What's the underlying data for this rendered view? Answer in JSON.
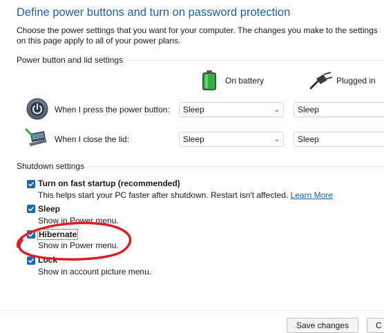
{
  "header": {
    "title": "Define power buttons and turn on password protection",
    "description": "Choose the power settings that you want for your computer. The changes you make to the settings on this page apply to all of your power plans."
  },
  "power_section": {
    "label": "Power button and lid settings",
    "columns": {
      "battery": "On battery",
      "plugged": "Plugged in"
    },
    "rows": [
      {
        "label": "When I press the power button:",
        "battery": "Sleep",
        "plugged": "Sleep"
      },
      {
        "label": "When I close the lid:",
        "battery": "Sleep",
        "plugged": "Sleep"
      }
    ]
  },
  "shutdown_section": {
    "label": "Shutdown settings",
    "options": [
      {
        "title": "Turn on fast startup (recommended)",
        "desc": "This helps start your PC faster after shutdown. Restart isn't affected.",
        "link": "Learn More",
        "checked": true
      },
      {
        "title": "Sleep",
        "desc": "Show in Power menu.",
        "checked": true
      },
      {
        "title": "Hibernate",
        "desc": "Show in Power menu.",
        "checked": true
      },
      {
        "title": "Lock",
        "desc": "Show in account picture menu.",
        "checked": true
      }
    ]
  },
  "footer": {
    "save_label": "Save changes",
    "cancel_label": "C"
  },
  "annotation": {
    "color": "#e01b24"
  },
  "icons": {
    "battery": "battery-icon",
    "plug": "plug-icon",
    "power": "power-button-icon",
    "lid": "laptop-lid-icon",
    "chevron": "chevron-down-icon",
    "check": "checkmark-icon"
  }
}
